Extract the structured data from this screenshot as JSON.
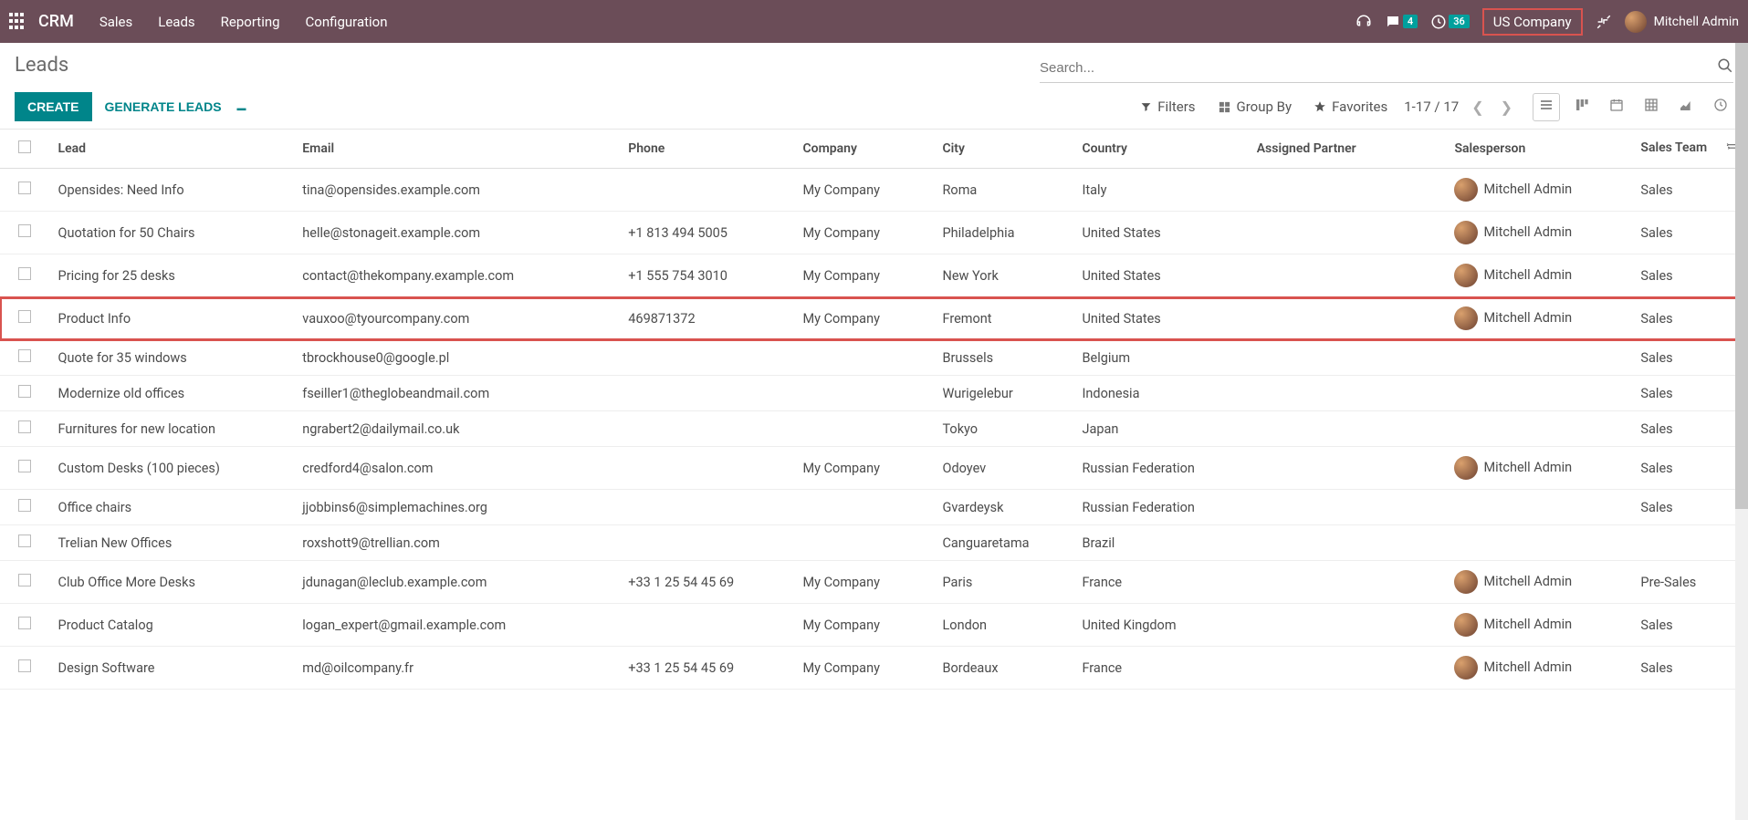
{
  "navbar": {
    "brand": "CRM",
    "menu": [
      "Sales",
      "Leads",
      "Reporting",
      "Configuration"
    ],
    "chat_badge": "4",
    "activity_badge": "36",
    "company": "US Company",
    "user": "Mitchell Admin"
  },
  "control": {
    "title": "Leads",
    "search_placeholder": "Search...",
    "create_label": "CREATE",
    "generate_label": "GENERATE LEADS",
    "filters_label": "Filters",
    "groupby_label": "Group By",
    "favorites_label": "Favorites",
    "pager": "1-17 / 17"
  },
  "columns": {
    "lead": "Lead",
    "email": "Email",
    "phone": "Phone",
    "company": "Company",
    "city": "City",
    "country": "Country",
    "partner": "Assigned Partner",
    "salesperson": "Salesperson",
    "team": "Sales Team"
  },
  "rows": [
    {
      "lead": "Opensides: Need Info",
      "email": "tina@opensides.example.com",
      "phone": "",
      "company": "My Company",
      "city": "Roma",
      "country": "Italy",
      "partner": "",
      "salesperson": "Mitchell Admin",
      "has_avatar": true,
      "team": "Sales",
      "highlight": false
    },
    {
      "lead": "Quotation for 50 Chairs",
      "email": "helle@stonageit.example.com",
      "phone": "+1 813 494 5005",
      "company": "My Company",
      "city": "Philadelphia",
      "country": "United States",
      "partner": "",
      "salesperson": "Mitchell Admin",
      "has_avatar": true,
      "team": "Sales",
      "highlight": false
    },
    {
      "lead": "Pricing for 25 desks",
      "email": "contact@thekompany.example.com",
      "phone": "+1 555 754 3010",
      "company": "My Company",
      "city": "New York",
      "country": "United States",
      "partner": "",
      "salesperson": "Mitchell Admin",
      "has_avatar": true,
      "team": "Sales",
      "highlight": false
    },
    {
      "lead": "Product Info",
      "email": "vauxoo@tyourcompany.com",
      "phone": "469871372",
      "company": "My Company",
      "city": "Fremont",
      "country": "United States",
      "partner": "",
      "salesperson": "Mitchell Admin",
      "has_avatar": true,
      "team": "Sales",
      "highlight": true
    },
    {
      "lead": "Quote for 35 windows",
      "email": "tbrockhouse0@google.pl",
      "phone": "",
      "company": "",
      "city": "Brussels",
      "country": "Belgium",
      "partner": "",
      "salesperson": "",
      "has_avatar": false,
      "team": "Sales",
      "highlight": false
    },
    {
      "lead": "Modernize old offices",
      "email": "fseiller1@theglobeandmail.com",
      "phone": "",
      "company": "",
      "city": "Wurigelebur",
      "country": "Indonesia",
      "partner": "",
      "salesperson": "",
      "has_avatar": false,
      "team": "Sales",
      "highlight": false
    },
    {
      "lead": "Furnitures for new location",
      "email": "ngrabert2@dailymail.co.uk",
      "phone": "",
      "company": "",
      "city": "Tokyo",
      "country": "Japan",
      "partner": "",
      "salesperson": "",
      "has_avatar": false,
      "team": "Sales",
      "highlight": false
    },
    {
      "lead": "Custom Desks (100 pieces)",
      "email": "credford4@salon.com",
      "phone": "",
      "company": "My Company",
      "city": "Odoyev",
      "country": "Russian Federation",
      "partner": "",
      "salesperson": "Mitchell Admin",
      "has_avatar": true,
      "team": "Sales",
      "highlight": false
    },
    {
      "lead": "Office chairs",
      "email": "jjobbins6@simplemachines.org",
      "phone": "",
      "company": "",
      "city": "Gvardeysk",
      "country": "Russian Federation",
      "partner": "",
      "salesperson": "",
      "has_avatar": false,
      "team": "Sales",
      "highlight": false
    },
    {
      "lead": "Trelian New Offices",
      "email": "roxshott9@trellian.com",
      "phone": "",
      "company": "",
      "city": "Canguaretama",
      "country": "Brazil",
      "partner": "",
      "salesperson": "",
      "has_avatar": false,
      "team": "",
      "highlight": false
    },
    {
      "lead": "Club Office More Desks",
      "email": "jdunagan@leclub.example.com",
      "phone": "+33 1 25 54 45 69",
      "company": "My Company",
      "city": "Paris",
      "country": "France",
      "partner": "",
      "salesperson": "Mitchell Admin",
      "has_avatar": true,
      "team": "Pre-Sales",
      "highlight": false
    },
    {
      "lead": "Product Catalog",
      "email": "logan_expert@gmail.example.com",
      "phone": "",
      "company": "My Company",
      "city": "London",
      "country": "United Kingdom",
      "partner": "",
      "salesperson": "Mitchell Admin",
      "has_avatar": true,
      "team": "Sales",
      "highlight": false
    },
    {
      "lead": "Design Software",
      "email": "md@oilcompany.fr",
      "phone": "+33 1 25 54 45 69",
      "company": "My Company",
      "city": "Bordeaux",
      "country": "France",
      "partner": "",
      "salesperson": "Mitchell Admin",
      "has_avatar": true,
      "team": "Sales",
      "highlight": false
    }
  ]
}
